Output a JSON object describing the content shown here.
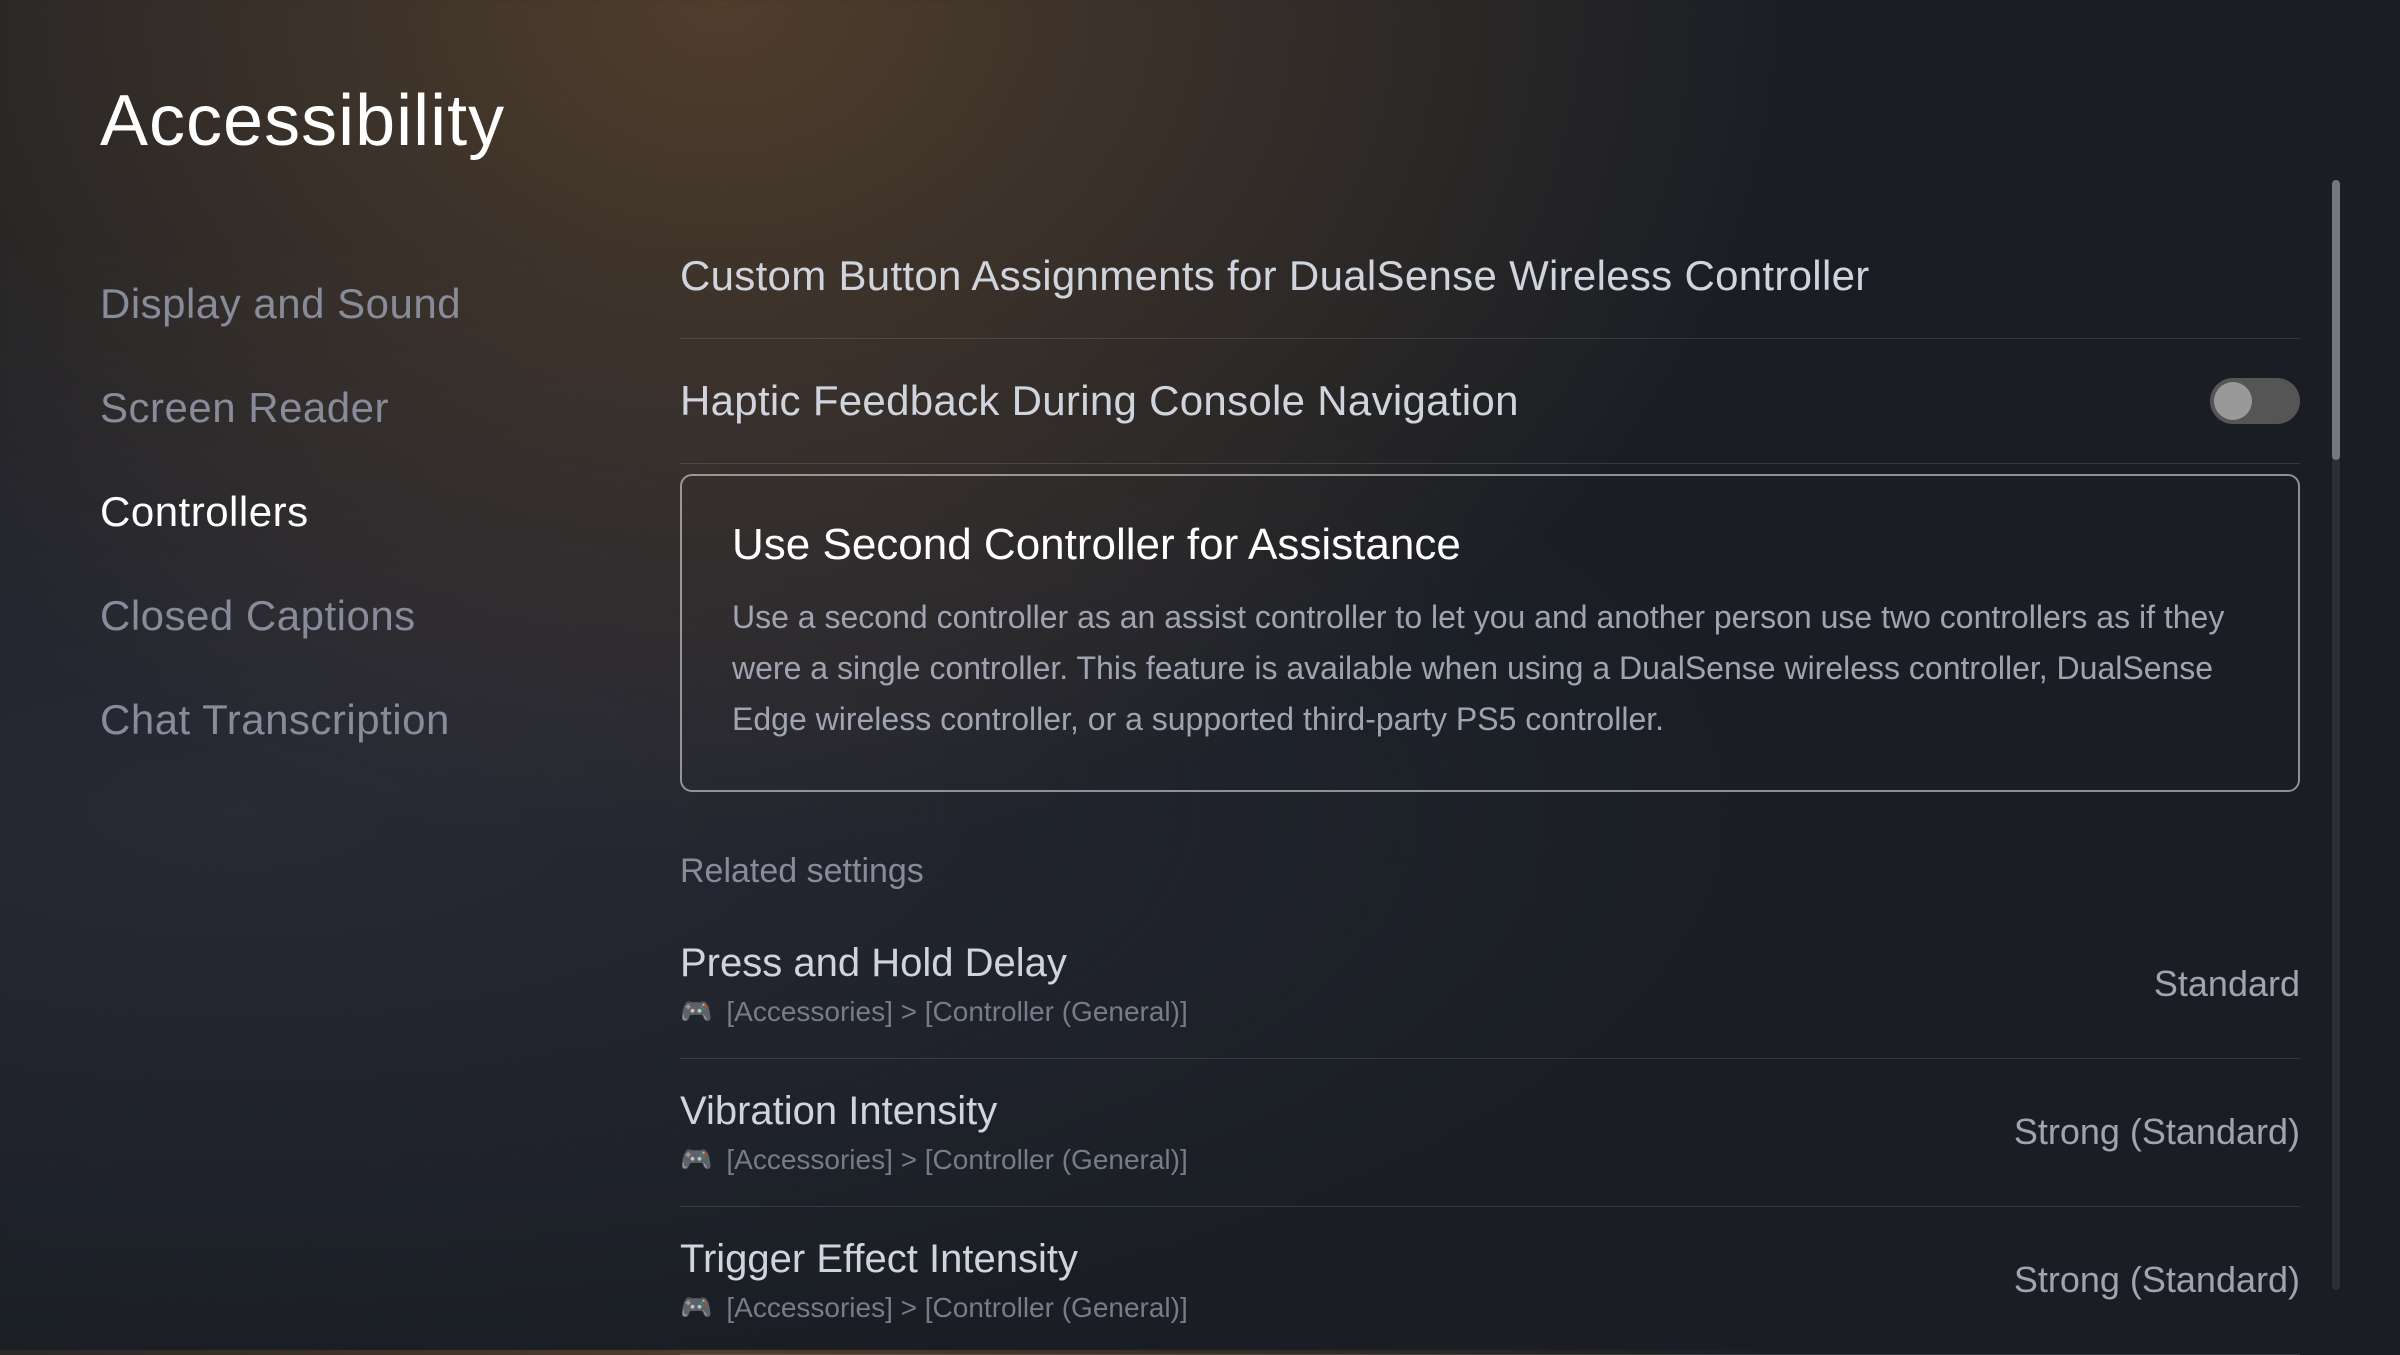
{
  "page": {
    "title": "Accessibility"
  },
  "sidebar": {
    "items": [
      {
        "id": "display-sound",
        "label": "Display and Sound",
        "active": false
      },
      {
        "id": "screen-reader",
        "label": "Screen Reader",
        "active": false
      },
      {
        "id": "controllers",
        "label": "Controllers",
        "active": true
      },
      {
        "id": "closed-captions",
        "label": "Closed Captions",
        "active": false
      },
      {
        "id": "chat-transcription",
        "label": "Chat Transcription",
        "active": false
      }
    ]
  },
  "main": {
    "settings": [
      {
        "id": "custom-button-assignments",
        "label": "Custom Button Assignments for DualSense Wireless Controller",
        "type": "link"
      },
      {
        "id": "haptic-feedback",
        "label": "Haptic Feedback During Console Navigation",
        "type": "toggle",
        "value": false
      }
    ],
    "selected_card": {
      "title": "Use Second Controller for Assistance",
      "description": "Use a second controller as an assist controller to let you and another person use two controllers as if they were a single controller. This feature is available when using a DualSense wireless controller, DualSense Edge wireless controller, or a supported third-party PS5 controller."
    },
    "related_settings_label": "Related settings",
    "related_settings": [
      {
        "id": "press-hold-delay",
        "title": "Press and Hold Delay",
        "path": "[Accessories] > [Controller (General)]",
        "value": "Standard"
      },
      {
        "id": "vibration-intensity",
        "title": "Vibration Intensity",
        "path": "[Accessories] > [Controller (General)]",
        "value": "Strong (Standard)"
      },
      {
        "id": "trigger-effect-intensity",
        "title": "Trigger Effect Intensity",
        "path": "[Accessories] > [Controller (General)]",
        "value": "Strong (Standard)"
      }
    ]
  }
}
